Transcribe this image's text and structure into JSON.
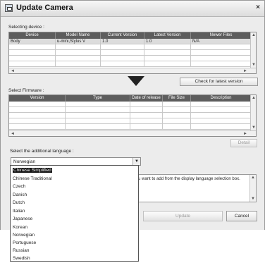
{
  "window": {
    "title": "Update Camera",
    "close_glyph": "×",
    "icon": "app-icon"
  },
  "device_section": {
    "label": "Selecting device :",
    "columns": [
      "Device",
      "Model Name",
      "Current Version",
      "Latest Version",
      "Newer Files"
    ],
    "rows": [
      [
        "Body",
        "u-mini,Stylus V",
        "1.0",
        "1.0",
        "N/A"
      ]
    ]
  },
  "check_button": "Check for latest version",
  "firmware_section": {
    "label": "Select Firmware :",
    "columns": [
      "Version",
      "Type",
      "Date of release",
      "File Size",
      "Description"
    ]
  },
  "detail_button": "Detail",
  "language_section": {
    "label": "Select the additional language :",
    "selected": "Norwegian",
    "options": [
      "Chinese Simplified",
      "Chinese Traditional",
      "Czech",
      "Danish",
      "Dutch",
      "Italian",
      "Japanese",
      "Korean",
      "Norwegian",
      "Portuguese",
      "Russian",
      "Swedish"
    ],
    "highlighted": "Chinese Simplified"
  },
  "hint_text": "u want to add from the display language selection box.",
  "update_button": "Update",
  "cancel_button": "Cancel",
  "scroll_glyphs": {
    "left": "◄",
    "right": "►",
    "up": "▲",
    "down": "▼"
  },
  "down_arrow_icon": "down-arrow-icon"
}
